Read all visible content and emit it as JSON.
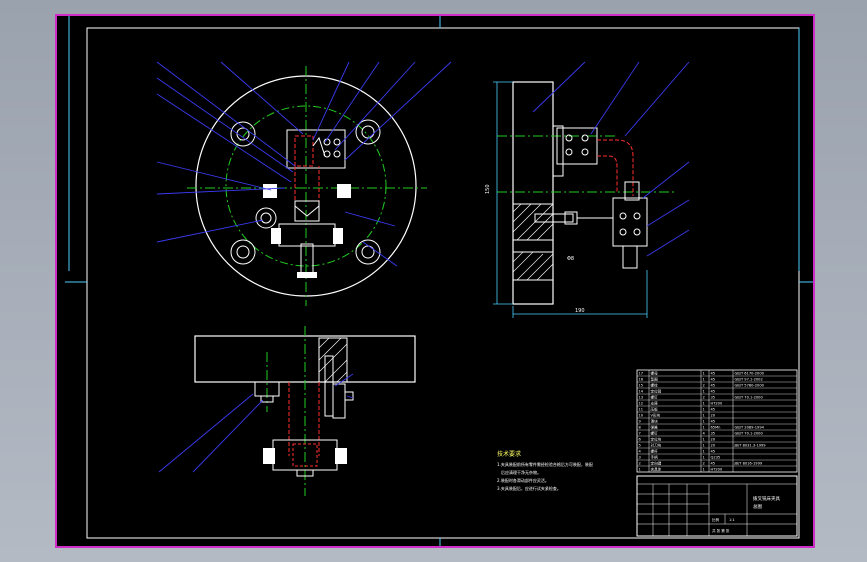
{
  "colors": {
    "background": "#000000",
    "outer_border": "#d02cc8",
    "outline": "#ffffff",
    "leader": "#3a3af0",
    "centerline": "#22cc22",
    "hidden": "#ff3030",
    "frame_inner": "#4ad0ff"
  },
  "notes": {
    "title": "技术要求",
    "lines": [
      "1.夹具装配前所有零件需经检验合格后方可装配，装配",
      "后应清理干净无杂物。",
      "2.装配时各滑动部件应灵活。",
      "3.夹具装配后，应进行试夹紧检查。"
    ]
  },
  "dimensions": {
    "width_label": "190",
    "height_label": "150",
    "small_label": "Φ8"
  },
  "title_block": {
    "drawing_name": "拨叉铣床夹具",
    "drawing_name_2": "总图",
    "scale_label": "比例",
    "scale_value": "1:1",
    "sheet_label": "共 张 第 张"
  },
  "parts_list": [
    {
      "no": "17",
      "name": "螺母",
      "qty": "1",
      "mat": "45",
      "std": "GB/T 6170-2000"
    },
    {
      "no": "16",
      "name": "垫圈",
      "qty": "1",
      "mat": "45",
      "std": "GB/T 97.1-2002"
    },
    {
      "no": "15",
      "name": "螺栓",
      "qty": "2",
      "mat": "45",
      "std": "GB/T 5780-2000"
    },
    {
      "no": "14",
      "name": "定位销",
      "qty": "1",
      "mat": "45",
      "std": ""
    },
    {
      "no": "13",
      "name": "螺钉",
      "qty": "2",
      "mat": "35",
      "std": "GB/T 70.1-2000"
    },
    {
      "no": "12",
      "name": "支座",
      "qty": "1",
      "mat": "HT200",
      "std": ""
    },
    {
      "no": "11",
      "name": "压板",
      "qty": "1",
      "mat": "45",
      "std": ""
    },
    {
      "no": "10",
      "name": "V形块",
      "qty": "1",
      "mat": "20",
      "std": ""
    },
    {
      "no": "9",
      "name": "滑块",
      "qty": "1",
      "mat": "45",
      "std": ""
    },
    {
      "no": "8",
      "name": "弹簧",
      "qty": "1",
      "mat": "65Mn",
      "std": "GB/T 2089-1994"
    },
    {
      "no": "7",
      "name": "螺钉",
      "qty": "4",
      "mat": "35",
      "std": "GB/T 70.1-2000"
    },
    {
      "no": "6",
      "name": "定位块",
      "qty": "1",
      "mat": "20",
      "std": ""
    },
    {
      "no": "5",
      "name": "对刀块",
      "qty": "1",
      "mat": "20",
      "std": "JB/T 8031.3-1999"
    },
    {
      "no": "4",
      "name": "螺杆",
      "qty": "1",
      "mat": "45",
      "std": ""
    },
    {
      "no": "3",
      "name": "手柄",
      "qty": "1",
      "mat": "Q235",
      "std": ""
    },
    {
      "no": "2",
      "name": "定向键",
      "qty": "2",
      "mat": "45",
      "std": "JB/T 8016-1999"
    },
    {
      "no": "1",
      "name": "夹具体",
      "qty": "1",
      "mat": "HT200",
      "std": ""
    }
  ]
}
